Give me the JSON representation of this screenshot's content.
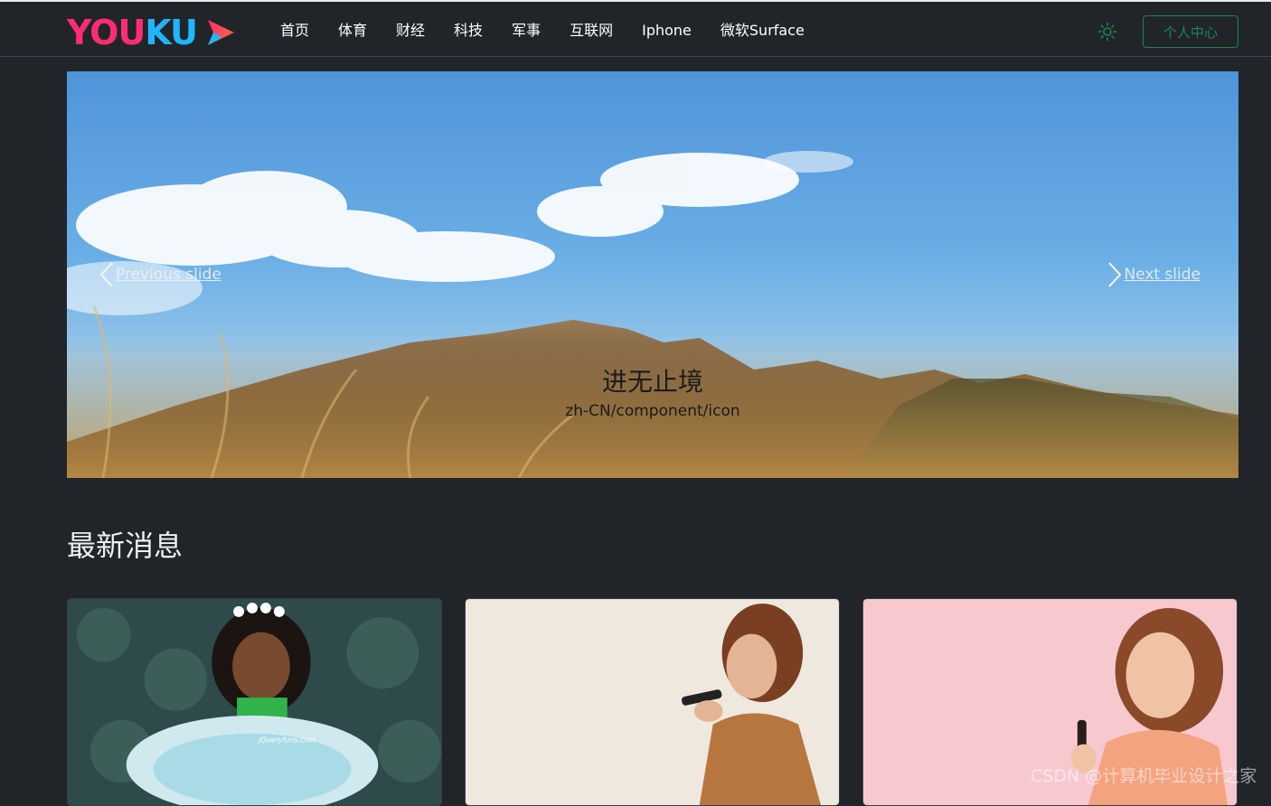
{
  "header": {
    "logo": {
      "text_part1": "YOU",
      "text_part2": "KU",
      "icon": "play-icon"
    },
    "nav": [
      {
        "label": "首页"
      },
      {
        "label": "体育"
      },
      {
        "label": "财经"
      },
      {
        "label": "科技"
      },
      {
        "label": "军事"
      },
      {
        "label": "互联网"
      },
      {
        "label": "Iphone"
      },
      {
        "label": "微软Surface"
      }
    ],
    "theme_icon": "sun-icon",
    "profile_label": "个人中心"
  },
  "carousel": {
    "prev_label": "Previous slide",
    "next_label": "Next slide",
    "caption_title": "进无止境",
    "caption_subtitle": "zh-CN/component/icon"
  },
  "news": {
    "title": "最新消息",
    "cards": [
      {
        "image": "girl-in-tutu-photo",
        "image_text": "jQueryfuns.com"
      },
      {
        "image": "woman-with-phone-photo"
      },
      {
        "image": "woman-on-call-photo"
      }
    ]
  },
  "watermark": "CSDN @计算机毕业设计之家",
  "colors": {
    "background": "#212529",
    "accent_green": "#198754",
    "logo_pink": "#ff2d6f",
    "logo_blue": "#1fb6ff"
  }
}
